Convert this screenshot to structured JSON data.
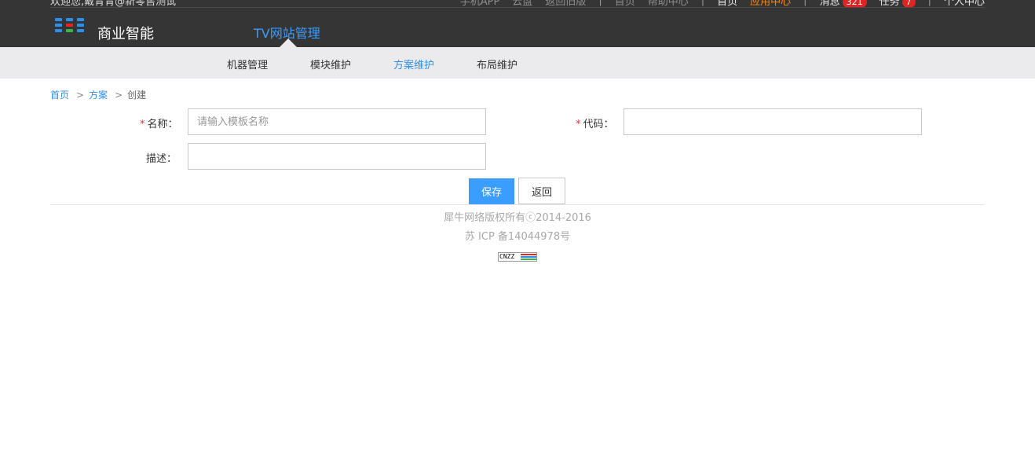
{
  "header": {
    "welcome": "欢迎您,戴青青@新零售测试",
    "links": [
      "手机APP",
      "云盘",
      "返回旧版"
    ],
    "links2": [
      "首页",
      "帮助中心"
    ],
    "home": "首页",
    "app_center": "应用中心",
    "messages_label": "消息",
    "messages_count": "321",
    "tasks_label": "任务",
    "tasks_count": "7",
    "personal_center": "个人中心",
    "brand": "商业智能",
    "main_nav": "TV网站管理",
    "logo_colors": [
      "#2f8fe6",
      "#e8e8e8",
      "#f5a623",
      "#3ab54a",
      "#e02424"
    ]
  },
  "subnav": {
    "items": [
      "机器管理",
      "模块维护",
      "方案维护",
      "布局维护"
    ],
    "active_index": 2
  },
  "breadcrumb": {
    "home": "首页",
    "section": "方案",
    "current": "创建"
  },
  "form": {
    "name_label": "名称：",
    "name_placeholder": "请输入模板名称",
    "name_value": "",
    "code_label": "代码：",
    "code_value": "",
    "desc_label": "描述：",
    "desc_value": "",
    "required_mark": "*",
    "save_label": "保存",
    "back_label": "返回"
  },
  "footer": {
    "copyright": "犀牛网络版权所有ⓒ2014-2016",
    "icp": "苏 ICP 备14044978号",
    "stat_badge": "CNZZ"
  },
  "colors": {
    "header_bg": "#353535",
    "accent": "#3a9dff",
    "subnav_bg": "#ebebee",
    "link": "#2f8fe6",
    "orange": "#ff8a00",
    "badge_red": "#e02424"
  }
}
